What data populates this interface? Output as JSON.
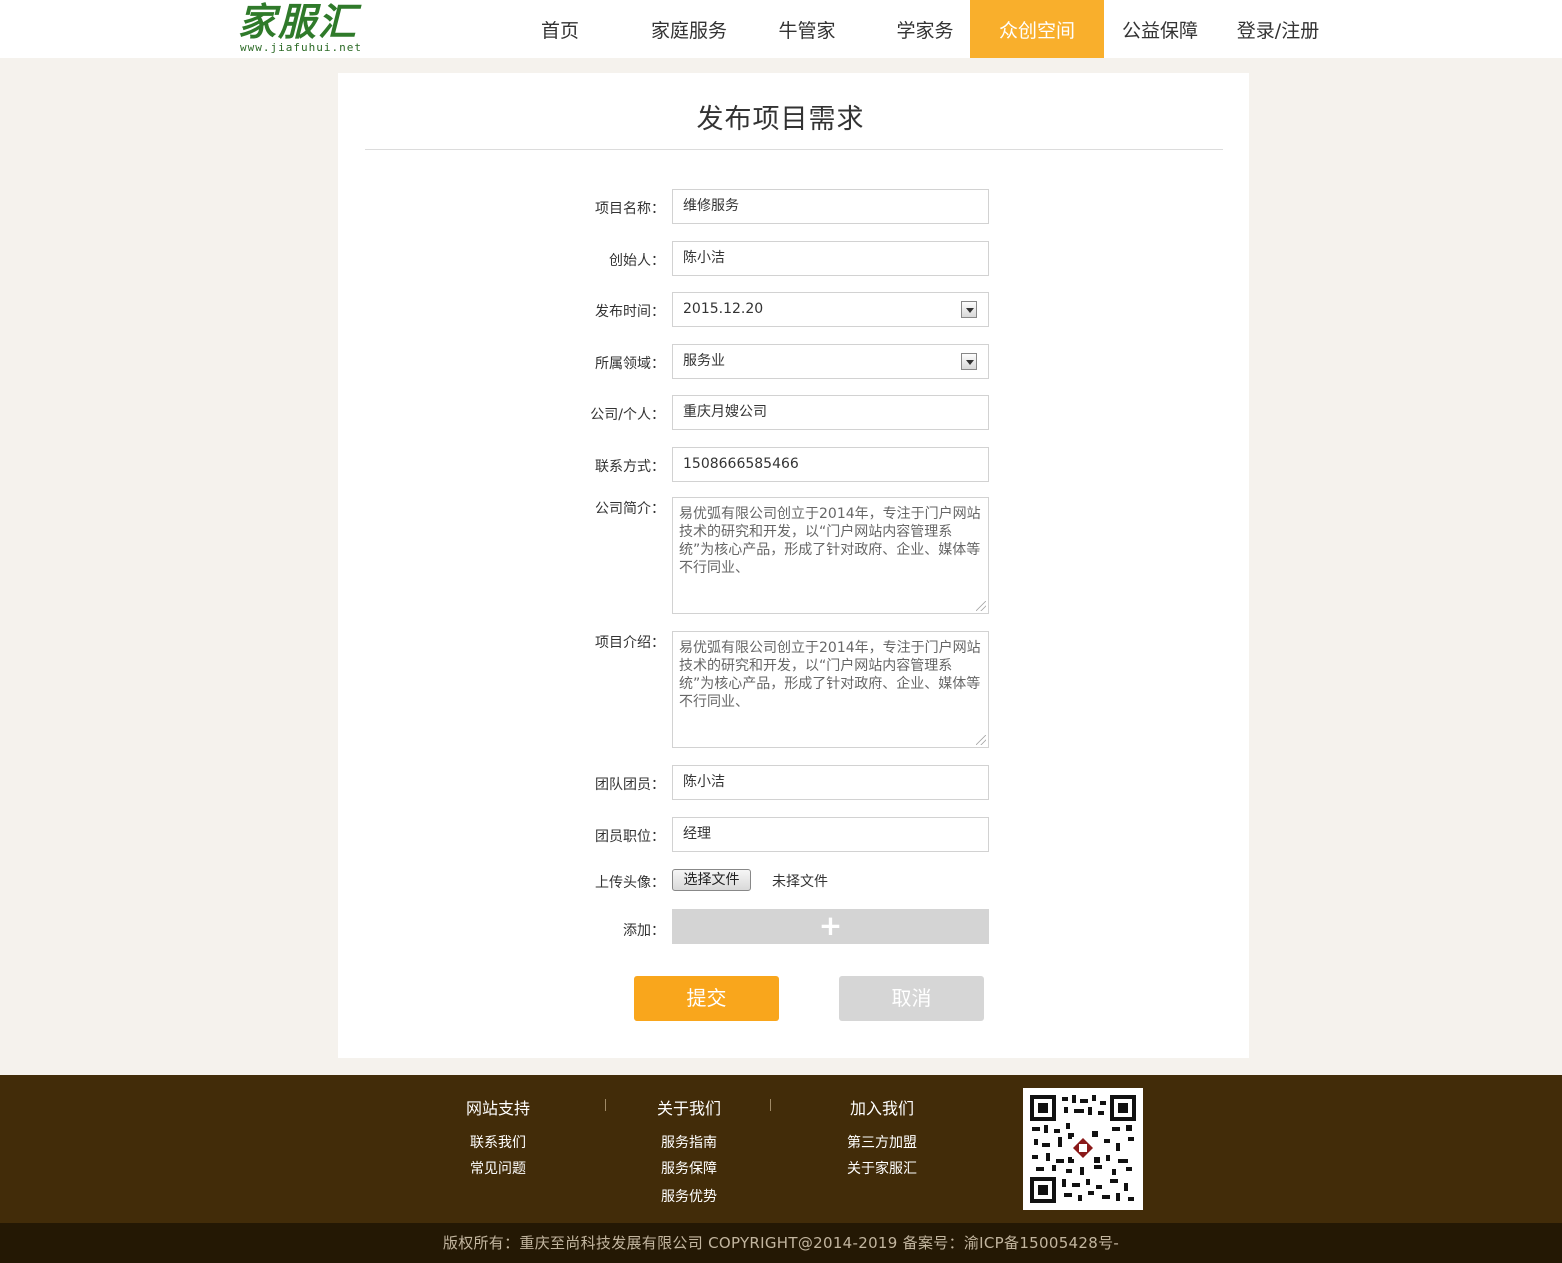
{
  "header": {
    "logo_cn": "家服汇",
    "logo_en": "www.jiafuhui.net",
    "nav": [
      {
        "label": "首页"
      },
      {
        "label": "家庭服务"
      },
      {
        "label": "牛管家"
      },
      {
        "label": "学家务"
      },
      {
        "label": "众创空间",
        "active": true
      },
      {
        "label": "公益保障"
      },
      {
        "label": "登录/注册"
      }
    ]
  },
  "form": {
    "title": "发布项目需求",
    "project_name": {
      "label": "项目名称：",
      "value": "维修服务"
    },
    "founder": {
      "label": "创始人：",
      "value": "陈小洁"
    },
    "publish_time": {
      "label": "发布时间：",
      "value": "2015.12.20"
    },
    "field": {
      "label": "所属领域：",
      "value": "服务业"
    },
    "company": {
      "label": "公司/个人：",
      "value": "重庆月嫂公司"
    },
    "contact": {
      "label": "联系方式：",
      "value": "1508666585466"
    },
    "company_intro": {
      "label": "公司简介：",
      "value": "易优弧有限公司创立于2014年，专注于门户网站技术的研究和开发，以“门户网站内容管理系统”为核心产品，形成了针对政府、企业、媒体等不行同业、"
    },
    "project_intro": {
      "label": "项目介绍：",
      "value": "易优弧有限公司创立于2014年，专注于门户网站技术的研究和开发，以“门户网站内容管理系统”为核心产品，形成了针对政府、企业、媒体等不行同业、"
    },
    "team_member": {
      "label": "团队团员：",
      "value": "陈小洁"
    },
    "member_position": {
      "label": "团员职位：",
      "value": "经理"
    },
    "avatar": {
      "label": "上传头像：",
      "button": "选择文件",
      "status": "未择文件"
    },
    "add": {
      "label": "添加：",
      "symbol": "+"
    },
    "submit": "提交",
    "cancel": "取消"
  },
  "footer": {
    "columns": [
      {
        "title": "网站支持",
        "links": [
          "联系我们",
          "常见问题"
        ]
      },
      {
        "title": "关于我们",
        "links": [
          "服务指南",
          "服务保障",
          "服务优势"
        ]
      },
      {
        "title": "加入我们",
        "links": [
          "第三方加盟",
          "关于家服汇"
        ]
      }
    ],
    "copyright": "版权所有：重庆至尚科技发展有限公司 COPYRIGHT@2014-2019 备案号：渝ICP备15005428号-"
  },
  "colors": {
    "accent": "#f9af2c",
    "submit": "#f9a61c",
    "footer": "#422c09",
    "footer_bottom": "#241804",
    "logo": "#2f7a2a"
  }
}
